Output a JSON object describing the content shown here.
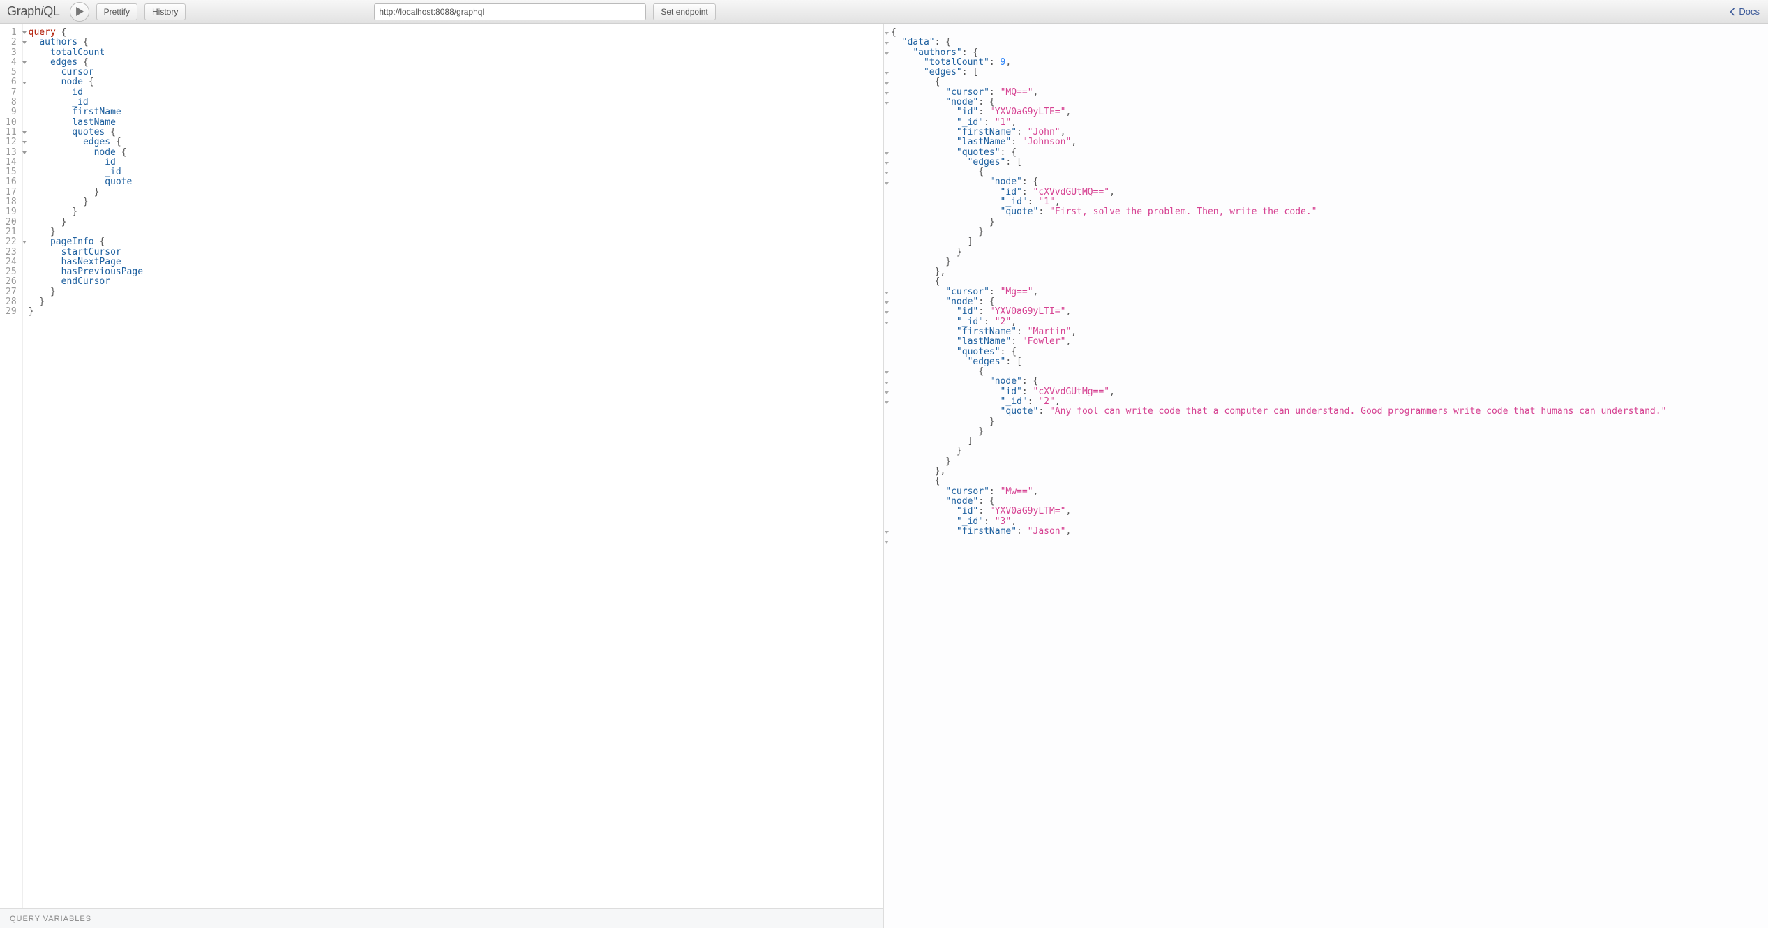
{
  "toolbar": {
    "logo_prefix": "Graph",
    "logo_i": "i",
    "logo_suffix": "QL",
    "prettify_label": "Prettify",
    "history_label": "History",
    "endpoint_value": "http://localhost:8088/graphql",
    "set_endpoint_label": "Set endpoint",
    "docs_label": "Docs"
  },
  "query": {
    "lines": [
      {
        "n": 1,
        "fold": true,
        "tokens": [
          [
            "kw",
            "query"
          ],
          [
            "p",
            " {"
          ]
        ]
      },
      {
        "n": 2,
        "fold": true,
        "tokens": [
          [
            "p",
            "  "
          ],
          [
            "field",
            "authors"
          ],
          [
            "p",
            " {"
          ]
        ]
      },
      {
        "n": 3,
        "fold": false,
        "tokens": [
          [
            "p",
            "    "
          ],
          [
            "field",
            "totalCount"
          ]
        ]
      },
      {
        "n": 4,
        "fold": true,
        "tokens": [
          [
            "p",
            "    "
          ],
          [
            "field",
            "edges"
          ],
          [
            "p",
            " {"
          ]
        ]
      },
      {
        "n": 5,
        "fold": false,
        "tokens": [
          [
            "p",
            "      "
          ],
          [
            "field",
            "cursor"
          ]
        ]
      },
      {
        "n": 6,
        "fold": true,
        "tokens": [
          [
            "p",
            "      "
          ],
          [
            "field",
            "node"
          ],
          [
            "p",
            " {"
          ]
        ]
      },
      {
        "n": 7,
        "fold": false,
        "tokens": [
          [
            "p",
            "        "
          ],
          [
            "field",
            "id"
          ]
        ]
      },
      {
        "n": 8,
        "fold": false,
        "tokens": [
          [
            "p",
            "        "
          ],
          [
            "field",
            "_id"
          ]
        ]
      },
      {
        "n": 9,
        "fold": false,
        "tokens": [
          [
            "p",
            "        "
          ],
          [
            "field",
            "firstName"
          ]
        ]
      },
      {
        "n": 10,
        "fold": false,
        "tokens": [
          [
            "p",
            "        "
          ],
          [
            "field",
            "lastName"
          ]
        ]
      },
      {
        "n": 11,
        "fold": true,
        "tokens": [
          [
            "p",
            "        "
          ],
          [
            "field",
            "quotes"
          ],
          [
            "p",
            " {"
          ]
        ]
      },
      {
        "n": 12,
        "fold": true,
        "tokens": [
          [
            "p",
            "          "
          ],
          [
            "field",
            "edges"
          ],
          [
            "p",
            " {"
          ]
        ]
      },
      {
        "n": 13,
        "fold": true,
        "tokens": [
          [
            "p",
            "            "
          ],
          [
            "field",
            "node"
          ],
          [
            "p",
            " {"
          ]
        ]
      },
      {
        "n": 14,
        "fold": false,
        "tokens": [
          [
            "p",
            "              "
          ],
          [
            "field",
            "id"
          ]
        ]
      },
      {
        "n": 15,
        "fold": false,
        "tokens": [
          [
            "p",
            "              "
          ],
          [
            "field",
            "_id"
          ]
        ]
      },
      {
        "n": 16,
        "fold": false,
        "tokens": [
          [
            "p",
            "              "
          ],
          [
            "field",
            "quote"
          ]
        ]
      },
      {
        "n": 17,
        "fold": false,
        "tokens": [
          [
            "p",
            "            }"
          ]
        ]
      },
      {
        "n": 18,
        "fold": false,
        "tokens": [
          [
            "p",
            "          }"
          ]
        ]
      },
      {
        "n": 19,
        "fold": false,
        "tokens": [
          [
            "p",
            "        }"
          ]
        ]
      },
      {
        "n": 20,
        "fold": false,
        "tokens": [
          [
            "p",
            "      }"
          ]
        ]
      },
      {
        "n": 21,
        "fold": false,
        "tokens": [
          [
            "p",
            "    }"
          ]
        ]
      },
      {
        "n": 22,
        "fold": true,
        "tokens": [
          [
            "p",
            "    "
          ],
          [
            "field",
            "pageInfo"
          ],
          [
            "p",
            " {"
          ]
        ]
      },
      {
        "n": 23,
        "fold": false,
        "tokens": [
          [
            "p",
            "      "
          ],
          [
            "field",
            "startCursor"
          ]
        ]
      },
      {
        "n": 24,
        "fold": false,
        "tokens": [
          [
            "p",
            "      "
          ],
          [
            "field",
            "hasNextPage"
          ]
        ]
      },
      {
        "n": 25,
        "fold": false,
        "tokens": [
          [
            "p",
            "      "
          ],
          [
            "field",
            "hasPreviousPage"
          ]
        ]
      },
      {
        "n": 26,
        "fold": false,
        "tokens": [
          [
            "p",
            "      "
          ],
          [
            "field",
            "endCursor"
          ]
        ]
      },
      {
        "n": 27,
        "fold": false,
        "tokens": [
          [
            "p",
            "    }"
          ]
        ]
      },
      {
        "n": 28,
        "fold": false,
        "tokens": [
          [
            "p",
            "  }"
          ]
        ]
      },
      {
        "n": 29,
        "fold": false,
        "tokens": [
          [
            "p",
            "}"
          ]
        ]
      }
    ]
  },
  "variables": {
    "label": "Query Variables"
  },
  "result": {
    "fold_rows": [
      0,
      1,
      2,
      4,
      5,
      6,
      7,
      12,
      13,
      14,
      15,
      26,
      27,
      28,
      29,
      34,
      35,
      36,
      37,
      50,
      51
    ],
    "lines": [
      [
        [
          "p",
          "{"
        ]
      ],
      [
        [
          "p",
          "  "
        ],
        [
          "key",
          "\"data\""
        ],
        [
          "p",
          ": {"
        ]
      ],
      [
        [
          "p",
          "    "
        ],
        [
          "key",
          "\"authors\""
        ],
        [
          "p",
          ": {"
        ]
      ],
      [
        [
          "p",
          "      "
        ],
        [
          "key",
          "\"totalCount\""
        ],
        [
          "p",
          ": "
        ],
        [
          "num",
          "9"
        ],
        [
          "p",
          ","
        ]
      ],
      [
        [
          "p",
          "      "
        ],
        [
          "key",
          "\"edges\""
        ],
        [
          "p",
          ": ["
        ]
      ],
      [
        [
          "p",
          "        {"
        ]
      ],
      [
        [
          "p",
          "          "
        ],
        [
          "key",
          "\"cursor\""
        ],
        [
          "p",
          ": "
        ],
        [
          "str",
          "\"MQ==\""
        ],
        [
          "p",
          ","
        ]
      ],
      [
        [
          "p",
          "          "
        ],
        [
          "key",
          "\"node\""
        ],
        [
          "p",
          ": {"
        ]
      ],
      [
        [
          "p",
          "            "
        ],
        [
          "key",
          "\"id\""
        ],
        [
          "p",
          ": "
        ],
        [
          "str",
          "\"YXV0aG9yLTE=\""
        ],
        [
          "p",
          ","
        ]
      ],
      [
        [
          "p",
          "            "
        ],
        [
          "key",
          "\"_id\""
        ],
        [
          "p",
          ": "
        ],
        [
          "str",
          "\"1\""
        ],
        [
          "p",
          ","
        ]
      ],
      [
        [
          "p",
          "            "
        ],
        [
          "key",
          "\"firstName\""
        ],
        [
          "p",
          ": "
        ],
        [
          "str",
          "\"John\""
        ],
        [
          "p",
          ","
        ]
      ],
      [
        [
          "p",
          "            "
        ],
        [
          "key",
          "\"lastName\""
        ],
        [
          "p",
          ": "
        ],
        [
          "str",
          "\"Johnson\""
        ],
        [
          "p",
          ","
        ]
      ],
      [
        [
          "p",
          "            "
        ],
        [
          "key",
          "\"quotes\""
        ],
        [
          "p",
          ": {"
        ]
      ],
      [
        [
          "p",
          "              "
        ],
        [
          "key",
          "\"edges\""
        ],
        [
          "p",
          ": ["
        ]
      ],
      [
        [
          "p",
          "                {"
        ]
      ],
      [
        [
          "p",
          "                  "
        ],
        [
          "key",
          "\"node\""
        ],
        [
          "p",
          ": {"
        ]
      ],
      [
        [
          "p",
          "                    "
        ],
        [
          "key",
          "\"id\""
        ],
        [
          "p",
          ": "
        ],
        [
          "str",
          "\"cXVvdGUtMQ==\""
        ],
        [
          "p",
          ","
        ]
      ],
      [
        [
          "p",
          "                    "
        ],
        [
          "key",
          "\"_id\""
        ],
        [
          "p",
          ": "
        ],
        [
          "str",
          "\"1\""
        ],
        [
          "p",
          ","
        ]
      ],
      [
        [
          "p",
          "                    "
        ],
        [
          "key",
          "\"quote\""
        ],
        [
          "p",
          ": "
        ],
        [
          "str",
          "\"First, solve the problem. Then, write the code.\""
        ]
      ],
      [
        [
          "p",
          "                  }"
        ]
      ],
      [
        [
          "p",
          "                }"
        ]
      ],
      [
        [
          "p",
          "              ]"
        ]
      ],
      [
        [
          "p",
          "            }"
        ]
      ],
      [
        [
          "p",
          "          }"
        ]
      ],
      [
        [
          "p",
          "        },"
        ]
      ],
      [
        [
          "p",
          "        {"
        ]
      ],
      [
        [
          "p",
          "          "
        ],
        [
          "key",
          "\"cursor\""
        ],
        [
          "p",
          ": "
        ],
        [
          "str",
          "\"Mg==\""
        ],
        [
          "p",
          ","
        ]
      ],
      [
        [
          "p",
          "          "
        ],
        [
          "key",
          "\"node\""
        ],
        [
          "p",
          ": {"
        ]
      ],
      [
        [
          "p",
          "            "
        ],
        [
          "key",
          "\"id\""
        ],
        [
          "p",
          ": "
        ],
        [
          "str",
          "\"YXV0aG9yLTI=\""
        ],
        [
          "p",
          ","
        ]
      ],
      [
        [
          "p",
          "            "
        ],
        [
          "key",
          "\"_id\""
        ],
        [
          "p",
          ": "
        ],
        [
          "str",
          "\"2\""
        ],
        [
          "p",
          ","
        ]
      ],
      [
        [
          "p",
          "            "
        ],
        [
          "key",
          "\"firstName\""
        ],
        [
          "p",
          ": "
        ],
        [
          "str",
          "\"Martin\""
        ],
        [
          "p",
          ","
        ]
      ],
      [
        [
          "p",
          "            "
        ],
        [
          "key",
          "\"lastName\""
        ],
        [
          "p",
          ": "
        ],
        [
          "str",
          "\"Fowler\""
        ],
        [
          "p",
          ","
        ]
      ],
      [
        [
          "p",
          "            "
        ],
        [
          "key",
          "\"quotes\""
        ],
        [
          "p",
          ": {"
        ]
      ],
      [
        [
          "p",
          "              "
        ],
        [
          "key",
          "\"edges\""
        ],
        [
          "p",
          ": ["
        ]
      ],
      [
        [
          "p",
          "                {"
        ]
      ],
      [
        [
          "p",
          "                  "
        ],
        [
          "key",
          "\"node\""
        ],
        [
          "p",
          ": {"
        ]
      ],
      [
        [
          "p",
          "                    "
        ],
        [
          "key",
          "\"id\""
        ],
        [
          "p",
          ": "
        ],
        [
          "str",
          "\"cXVvdGUtMg==\""
        ],
        [
          "p",
          ","
        ]
      ],
      [
        [
          "p",
          "                    "
        ],
        [
          "key",
          "\"_id\""
        ],
        [
          "p",
          ": "
        ],
        [
          "str",
          "\"2\""
        ],
        [
          "p",
          ","
        ]
      ],
      [
        [
          "p",
          "                    "
        ],
        [
          "key",
          "\"quote\""
        ],
        [
          "p",
          ": "
        ],
        [
          "str",
          "\"Any fool can write code that a computer can understand. Good programmers write code that humans can understand.\""
        ]
      ],
      [
        [
          "p",
          "                  }"
        ]
      ],
      [
        [
          "p",
          "                }"
        ]
      ],
      [
        [
          "p",
          "              ]"
        ]
      ],
      [
        [
          "p",
          "            }"
        ]
      ],
      [
        [
          "p",
          "          }"
        ]
      ],
      [
        [
          "p",
          "        },"
        ]
      ],
      [
        [
          "p",
          "        {"
        ]
      ],
      [
        [
          "p",
          "          "
        ],
        [
          "key",
          "\"cursor\""
        ],
        [
          "p",
          ": "
        ],
        [
          "str",
          "\"Mw==\""
        ],
        [
          "p",
          ","
        ]
      ],
      [
        [
          "p",
          "          "
        ],
        [
          "key",
          "\"node\""
        ],
        [
          "p",
          ": {"
        ]
      ],
      [
        [
          "p",
          "            "
        ],
        [
          "key",
          "\"id\""
        ],
        [
          "p",
          ": "
        ],
        [
          "str",
          "\"YXV0aG9yLTM=\""
        ],
        [
          "p",
          ","
        ]
      ],
      [
        [
          "p",
          "            "
        ],
        [
          "key",
          "\"_id\""
        ],
        [
          "p",
          ": "
        ],
        [
          "str",
          "\"3\""
        ],
        [
          "p",
          ","
        ]
      ],
      [
        [
          "p",
          "            "
        ],
        [
          "key",
          "\"firstName\""
        ],
        [
          "p",
          ": "
        ],
        [
          "str",
          "\"Jason\""
        ],
        [
          "p",
          ","
        ]
      ]
    ]
  }
}
